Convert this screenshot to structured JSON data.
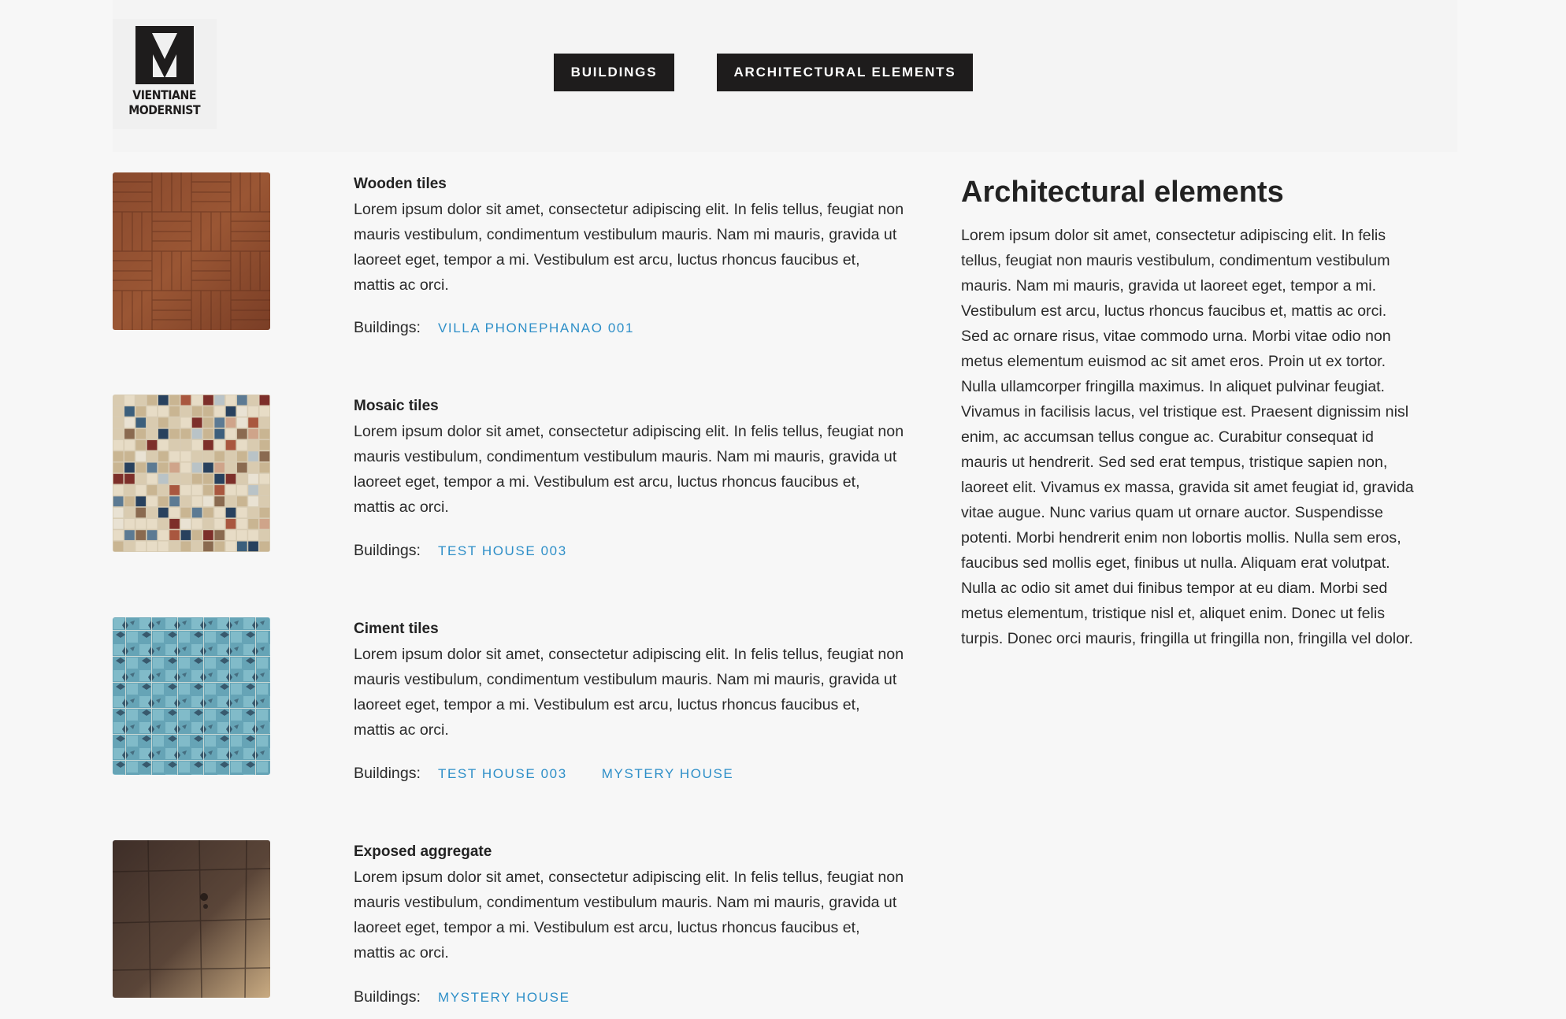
{
  "logo": {
    "text_line1": "VIENTIANE",
    "text_line2": "MODERNIST"
  },
  "nav": {
    "buildings": "BUILDINGS",
    "architectural_elements": "ARCHITECTURAL ELEMENTS"
  },
  "buildings_label": "Buildings:",
  "items": [
    {
      "title": "Wooden tiles",
      "description": "Lorem ipsum dolor sit amet, consectetur adipiscing elit. In felis tellus, feugiat non mauris vestibulum, condimentum vestibulum mauris. Nam mi mauris, gravida ut laoreet eget, tempor a mi. Vestibulum est arcu, luctus rhoncus faucibus et, mattis ac orci.",
      "buildings": [
        "VILLA PHONEPHANAO 001"
      ]
    },
    {
      "title": "Mosaic tiles",
      "description": "Lorem ipsum dolor sit amet, consectetur adipiscing elit. In felis tellus, feugiat non mauris vestibulum, condimentum vestibulum mauris. Nam mi mauris, gravida ut laoreet eget, tempor a mi. Vestibulum est arcu, luctus rhoncus faucibus et, mattis ac orci.",
      "buildings": [
        "TEST HOUSE 003"
      ]
    },
    {
      "title": "Ciment tiles",
      "description": "Lorem ipsum dolor sit amet, consectetur adipiscing elit. In felis tellus, feugiat non mauris vestibulum, condimentum vestibulum mauris. Nam mi mauris, gravida ut laoreet eget, tempor a mi. Vestibulum est arcu, luctus rhoncus faucibus et, mattis ac orci.",
      "buildings": [
        "TEST HOUSE 003",
        "MYSTERY HOUSE"
      ]
    },
    {
      "title": "Exposed aggregate",
      "description": "Lorem ipsum dolor sit amet, consectetur adipiscing elit. In felis tellus, feugiat non mauris vestibulum, condimentum vestibulum mauris. Nam mi mauris, gravida ut laoreet eget, tempor a mi. Vestibulum est arcu, luctus rhoncus faucibus et, mattis ac orci.",
      "buildings": [
        "MYSTERY HOUSE"
      ]
    }
  ],
  "sidebar": {
    "title": "Architectural elements",
    "body": "Lorem ipsum dolor sit amet, consectetur adipiscing elit. In felis tellus, feugiat non mauris vestibulum, condimentum vestibulum mauris. Nam mi mauris, gravida ut laoreet eget, tempor a mi. Vestibulum est arcu, luctus rhoncus faucibus et, mattis ac orci. Sed ac ornare risus, vitae commodo urna. Morbi vitae odio non metus elementum euismod ac sit amet eros. Proin ut ex tortor. Nulla ullamcorper fringilla maximus. In aliquet pulvinar feugiat. Vivamus in facilisis lacus, vel tristique est. Praesent dignissim nisl enim, ac accumsan tellus congue ac. Curabitur consequat id mauris ut hendrerit. Sed sed erat tempus, tristique sapien non, laoreet elit. Vivamus ex massa, gravida sit amet feugiat id, gravida vitae augue. Nunc varius quam ut ornare auctor. Suspendisse potenti. Morbi hendrerit enim non lobortis mollis. Nulla sem eros, faucibus sed mollis eget, finibus ut nulla. Aliquam erat volutpat. Nulla ac odio sit amet dui finibus tempor at eu diam. Morbi sed metus elementum, tristique nisl et, aliquet enim. Donec ut felis turpis. Donec orci mauris, fringilla ut fringilla non, fringilla vel dolor."
  },
  "colors": {
    "nav_bg": "#1e1c1c",
    "link": "#2e8fc8",
    "page_bg": "#f7f7f7"
  }
}
